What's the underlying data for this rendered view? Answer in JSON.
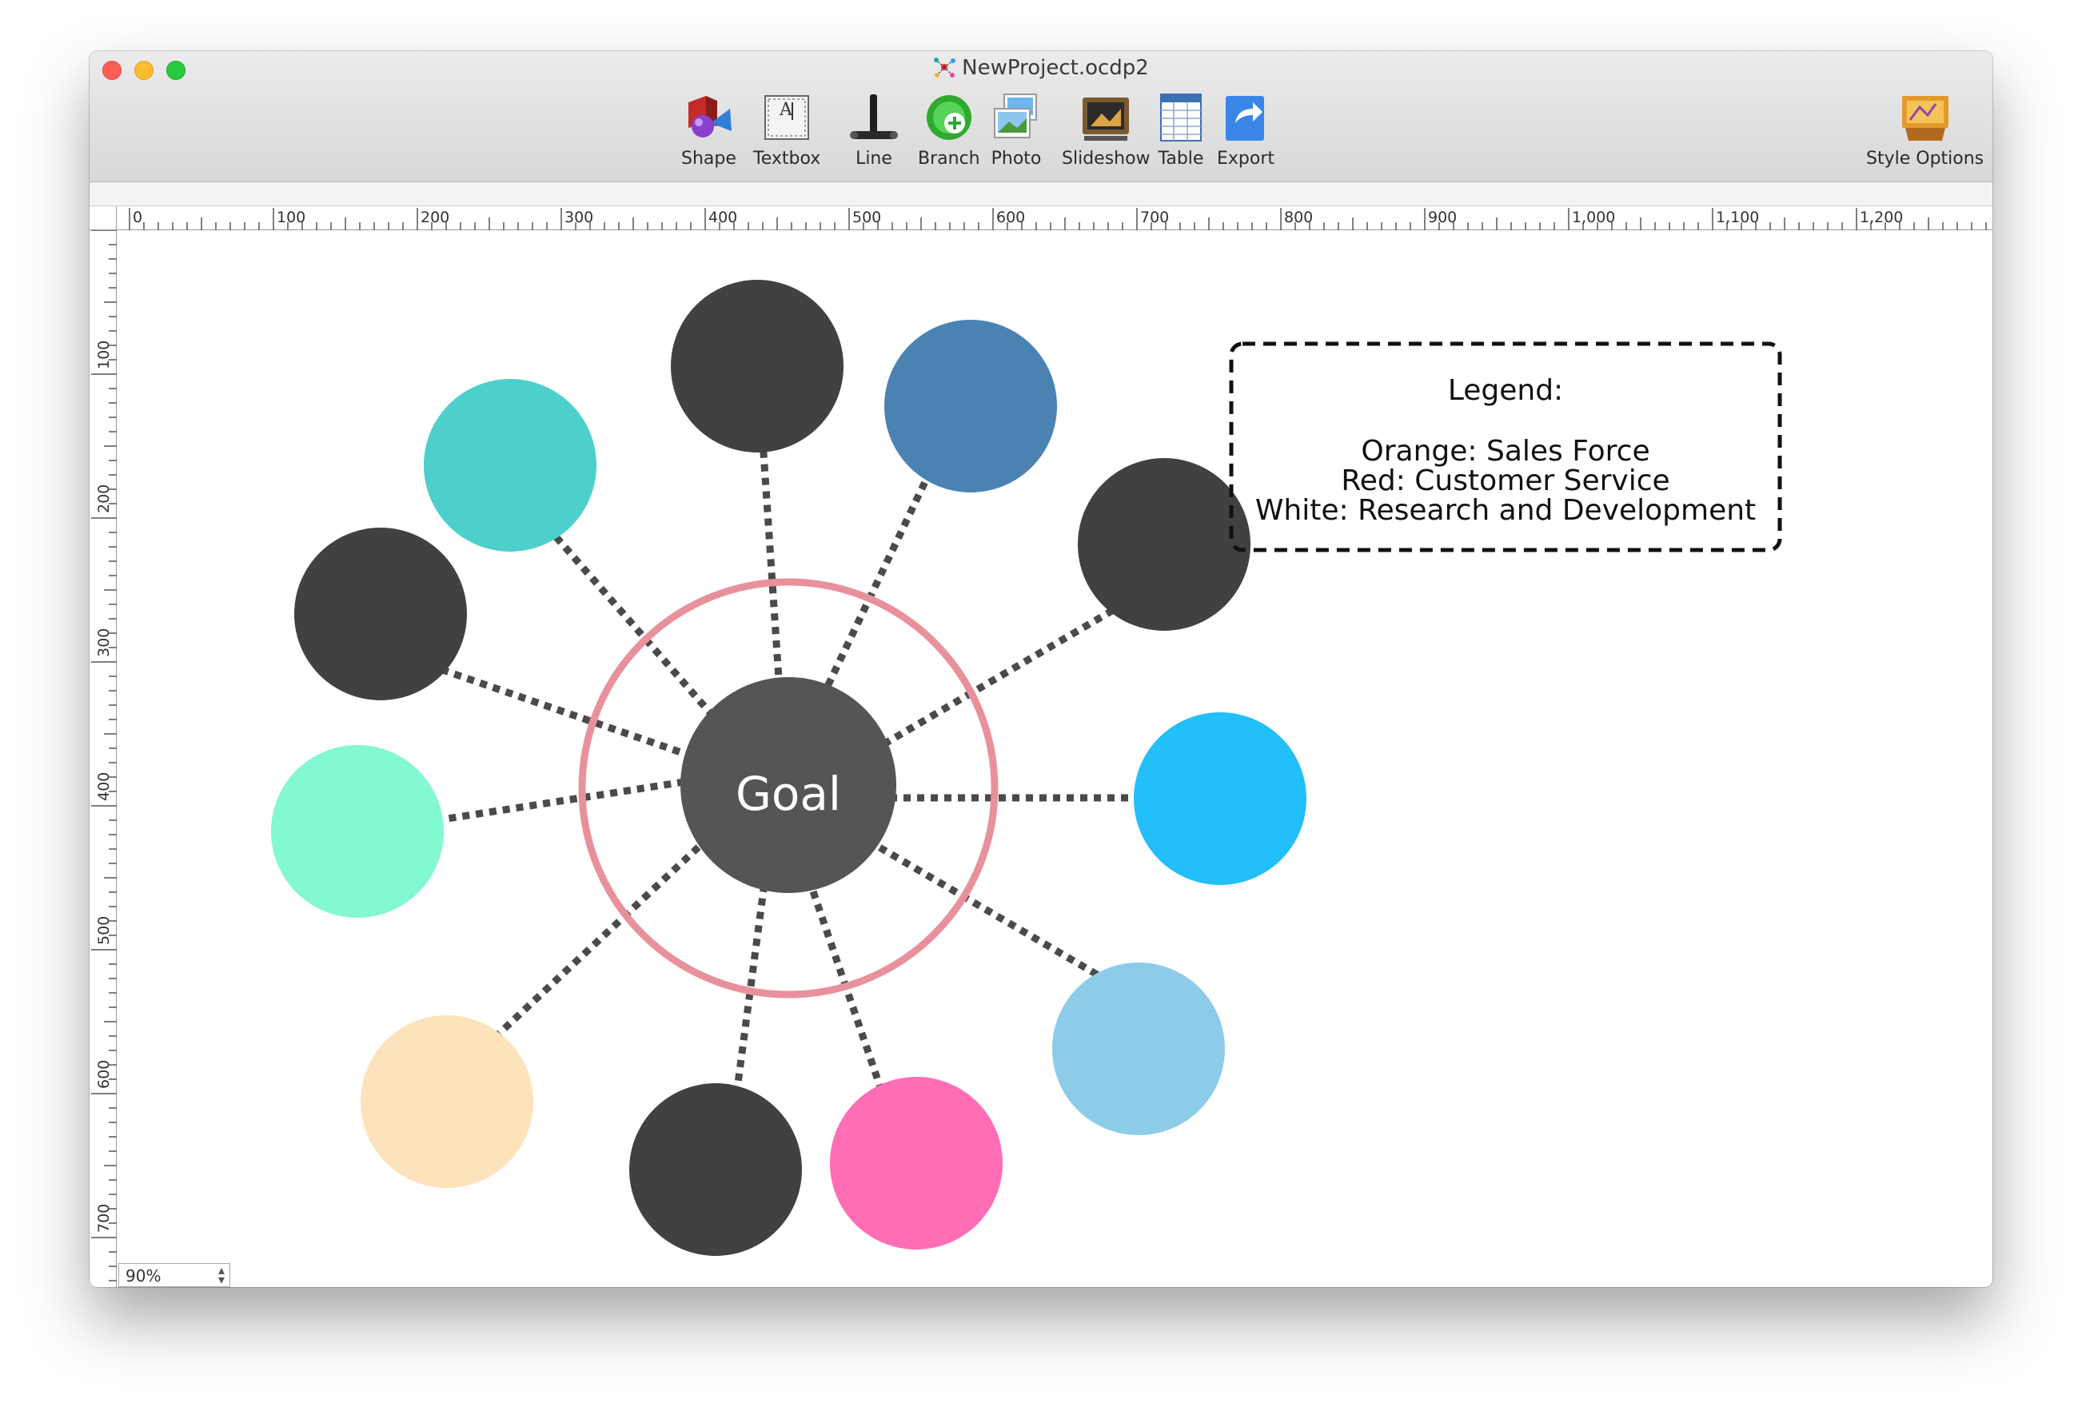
{
  "window": {
    "title": "NewProject.ocdp2"
  },
  "toolbar": {
    "tools": [
      {
        "id": "shape",
        "label": "Shape"
      },
      {
        "id": "textbox",
        "label": "Textbox"
      },
      {
        "id": "line",
        "label": "Line"
      },
      {
        "id": "branch",
        "label": "Branch"
      },
      {
        "id": "photo",
        "label": "Photo"
      },
      {
        "id": "slideshow",
        "label": "Slideshow"
      },
      {
        "id": "table",
        "label": "Table"
      },
      {
        "id": "export",
        "label": "Export"
      }
    ],
    "style_options_label": "Style Options"
  },
  "rulers": {
    "horizontal_labels": [
      "0",
      "100",
      "200",
      "300",
      "400",
      "500",
      "600",
      "700",
      "800",
      "900",
      "1,000",
      "1,100",
      "1,200"
    ],
    "vertical_labels": [
      "100",
      "200",
      "300",
      "400",
      "500",
      "600",
      "700"
    ]
  },
  "diagram": {
    "center_label": "Goal",
    "center_color": "#555555",
    "ring_color": "#e8919d",
    "connector_color": "#4a4a4a",
    "nodes": [
      {
        "id": "node-top",
        "color": "#414141"
      },
      {
        "id": "node-steel-blue",
        "color": "#4a83b2"
      },
      {
        "id": "node-upper-right",
        "color": "#414141"
      },
      {
        "id": "node-sky-blue",
        "color": "#22bffa"
      },
      {
        "id": "node-light-blue",
        "color": "#8ccce9"
      },
      {
        "id": "node-pink",
        "color": "#ff6eb5"
      },
      {
        "id": "node-bottom",
        "color": "#414141"
      },
      {
        "id": "node-peach",
        "color": "#fde3bb"
      },
      {
        "id": "node-mint",
        "color": "#82f8d3"
      },
      {
        "id": "node-left",
        "color": "#414141"
      },
      {
        "id": "node-teal",
        "color": "#4dd0cb"
      }
    ]
  },
  "legend": {
    "title": "Legend:",
    "lines": [
      "Orange:  Sales Force",
      "Red:  Customer Service",
      "White: Research and Development"
    ]
  },
  "zoom": {
    "value": "90%"
  }
}
